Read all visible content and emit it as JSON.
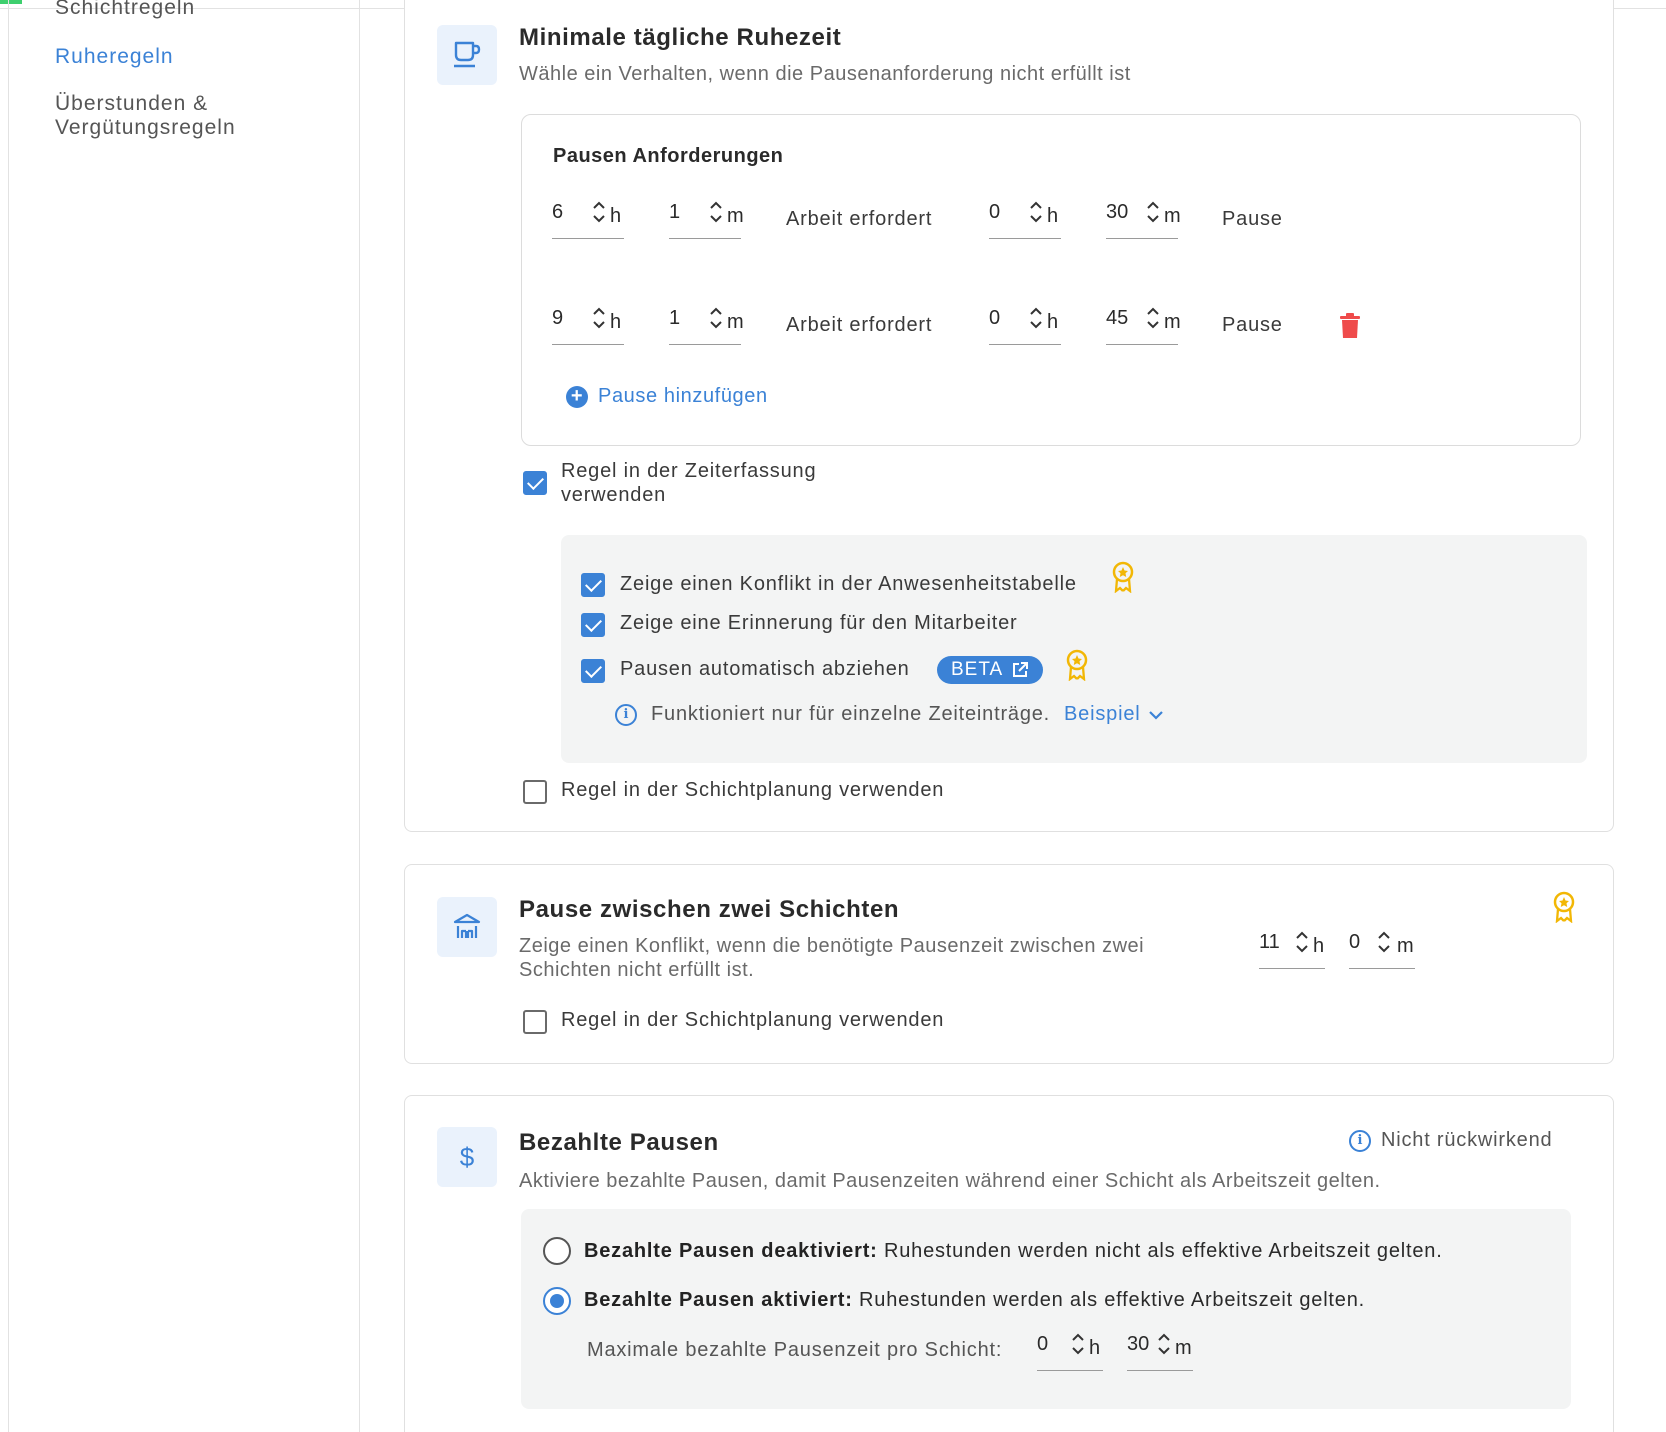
{
  "sidebar": {
    "items": [
      {
        "label": "Schichtregeln"
      },
      {
        "label": "Ruheregeln"
      },
      {
        "label": "Überstunden & Vergütungsregeln"
      }
    ]
  },
  "daily_rest": {
    "title": "Minimale tägliche Ruhezeit",
    "subtitle": "Wähle ein Verhalten, wenn die Pausenanforderung nicht erfüllt ist",
    "requirements_title": "Pausen Anforderungen",
    "rows": [
      {
        "work_h": "6",
        "work_m": "1",
        "label": "Arbeit erfordert",
        "pause_h": "0",
        "pause_m": "30",
        "suffix": "Pause"
      },
      {
        "work_h": "9",
        "work_m": "1",
        "label": "Arbeit erfordert",
        "pause_h": "0",
        "pause_m": "45",
        "suffix": "Pause"
      }
    ],
    "unit_h": "h",
    "unit_m": "m",
    "add_label": "Pause hinzufügen",
    "time_tracking_rule": "Regel in der Zeiterfassung verwenden",
    "time_tracking_checked": true,
    "options": [
      {
        "label": "Zeige einen Konflikt in der Anwesenheitstabelle",
        "checked": true
      },
      {
        "label": "Zeige eine Erinnerung für den Mitarbeiter",
        "checked": true
      },
      {
        "label": "Pausen automatisch abziehen",
        "checked": true
      }
    ],
    "beta_label": "BETA",
    "info_text": "Funktioniert nur für einzelne Zeiteinträge.",
    "example_label": "Beispiel",
    "shift_planning_rule": "Regel in der Schichtplanung verwenden",
    "shift_planning_checked": false
  },
  "between_shifts": {
    "title": "Pause zwischen zwei Schichten",
    "subtitle": "Zeige einen Konflikt, wenn die benötigte Pausenzeit zwischen zwei Schichten nicht erfüllt ist.",
    "hours": "11",
    "minutes": "0",
    "shift_planning_rule": "Regel in der Schichtplanung verwenden",
    "shift_planning_checked": false
  },
  "paid_breaks": {
    "title": "Bezahlte Pausen",
    "subtitle": "Aktiviere bezahlte Pausen, damit Pausenzeiten während einer Schicht als Arbeitszeit gelten.",
    "not_retroactive": "Nicht rückwirkend",
    "option_off_bold": "Bezahlte Pausen deaktiviert:",
    "option_off_text": "Ruhestunden werden nicht als effektive Arbeitszeit gelten.",
    "option_on_bold": "Bezahlte Pausen aktiviert:",
    "option_on_text": "Ruhestunden werden als effektive Arbeitszeit gelten.",
    "selected": "on",
    "max_label": "Maximale bezahlte Pausenzeit pro Schicht:",
    "max_h": "0",
    "max_m": "30"
  },
  "colors": {
    "accent": "#3b82d6",
    "premium": "#f2b705",
    "delete": "#ef4b4b",
    "top_accent": "#3ecf6e"
  }
}
